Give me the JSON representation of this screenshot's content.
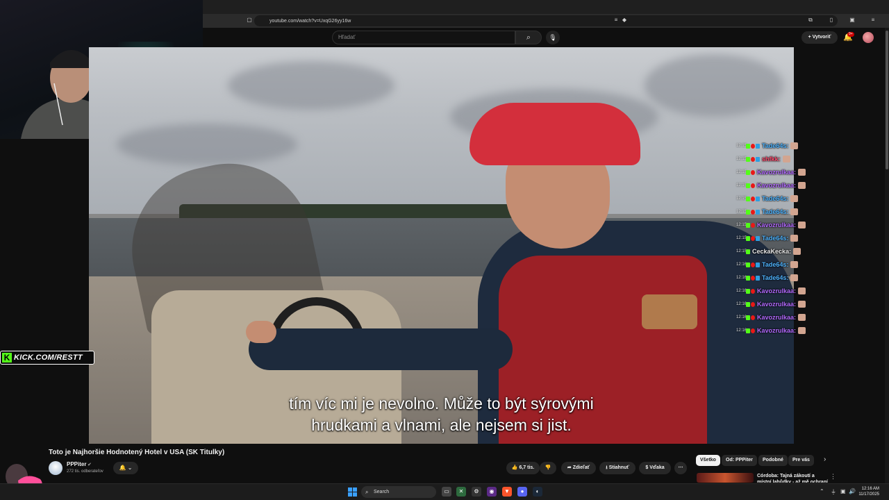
{
  "browser": {
    "url": "youtube.com/watch?v=UxqG26yy16w",
    "notification_count": "9+"
  },
  "youtube": {
    "search_placeholder": "Hľadať",
    "create_label": "Vytvoriť",
    "bell_badge": "9+"
  },
  "video": {
    "subtitle_line1": "tím víc mi je nevolno. Může to být sýrovými",
    "subtitle_line2": "hrudkami a vlnami, ale nejsem si jist.",
    "title": "Toto je Najhoršie Hodnotený Hotel v USA (SK Titulky)"
  },
  "channel": {
    "name": "PPPiter",
    "subscribers": "272 tis. odberateľov"
  },
  "actions": {
    "likes": "6,7 tis.",
    "share": "Zdieľať",
    "download": "Stiahnuť",
    "thanks": "Vďaka"
  },
  "chips": [
    "Všetko",
    "Od: PPPiter",
    "Podobné",
    "Pre vás"
  ],
  "recommendation": {
    "title": "Córdoba: Tajná zákoutí a místní lahůdky - až mě ochraní místní"
  },
  "overlay": {
    "kick_url": "KICK.COM/RESTT"
  },
  "chat": [
    {
      "time": "12:15",
      "user": "Tade64s:",
      "color": "#4fb4ff",
      "badges": [
        "green",
        "red",
        "blue"
      ]
    },
    {
      "time": "12:15",
      "user": "shfkk:",
      "color": "#ff4a6e",
      "badges": [
        "green",
        "red",
        "blue"
      ]
    },
    {
      "time": "12:15",
      "user": "Kavozrulkaa:",
      "color": "#b36bff",
      "badges": [
        "green",
        "red"
      ]
    },
    {
      "time": "12:15",
      "user": "Kavozrulkaa:",
      "color": "#b36bff",
      "badges": [
        "green",
        "red"
      ]
    },
    {
      "time": "12:15",
      "user": "Tade64s:",
      "color": "#4fb4ff",
      "badges": [
        "green",
        "red",
        "blue"
      ]
    },
    {
      "time": "12:15",
      "user": "Tade64s:",
      "color": "#4fb4ff",
      "badges": [
        "green",
        "red",
        "blue"
      ]
    },
    {
      "time": "12:15",
      "user": "Kavozrulkaa:",
      "color": "#b36bff",
      "badges": [
        "green",
        "red"
      ]
    },
    {
      "time": "12:15",
      "user": "Tade64s:",
      "color": "#4fb4ff",
      "badges": [
        "green",
        "red",
        "blue"
      ]
    },
    {
      "time": "12:15",
      "user": "CeckaKecka:",
      "color": "#e8e8e8",
      "badges": [
        "green"
      ]
    },
    {
      "time": "12:16",
      "user": "Tade64s:",
      "color": "#4fb4ff",
      "badges": [
        "green",
        "red",
        "blue"
      ]
    },
    {
      "time": "12:16",
      "user": "Tade64s:",
      "color": "#4fb4ff",
      "badges": [
        "green",
        "red",
        "blue"
      ]
    },
    {
      "time": "12:16",
      "user": "Kavozrulkaa:",
      "color": "#b36bff",
      "badges": [
        "green",
        "red"
      ]
    },
    {
      "time": "12:16",
      "user": "Kavozrulkaa:",
      "color": "#b36bff",
      "badges": [
        "green",
        "red"
      ]
    },
    {
      "time": "12:16",
      "user": "Kavozrulkaa:",
      "color": "#b36bff",
      "badges": [
        "green",
        "red"
      ]
    },
    {
      "time": "12:16",
      "user": "Kavozrulkaa:",
      "color": "#b36bff",
      "badges": [
        "green",
        "red"
      ]
    }
  ],
  "taskbar": {
    "search_label": "Search",
    "time": "12:16 AM",
    "date": "11/17/2025"
  }
}
